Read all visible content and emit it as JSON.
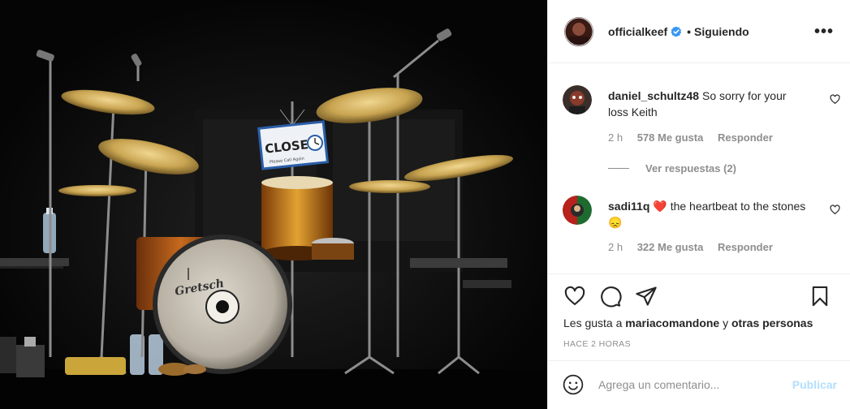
{
  "post": {
    "username": "officialkeef",
    "separator": "•",
    "follow_status": "Siguiendo",
    "more_label": "•••",
    "closed_sign": {
      "title": "CLOSED",
      "subtitle": "Please Call Again"
    },
    "drum_brand": "Gretsch"
  },
  "comments": [
    {
      "user": "daniel_schultz48",
      "text": "So sorry for your loss Keith",
      "time": "2 h",
      "likes": "578 Me gusta",
      "reply": "Responder"
    },
    {
      "user": "sadi11q",
      "text": "❤️ the heartbeat to the stones 😞",
      "time": "2 h",
      "likes": "322 Me gusta",
      "reply": "Responder"
    }
  ],
  "view_replies": "Ver respuestas (2)",
  "likes_line": {
    "prefix": "Les gusta a",
    "user": "mariacomandone",
    "joiner": "y",
    "others": "otras personas"
  },
  "time_ago": "HACE 2 HORAS",
  "add_comment": {
    "placeholder": "Agrega un comentario...",
    "publish": "Publicar"
  },
  "colors": {
    "verified": "#3897f0",
    "publish_disabled": "#b2dffc",
    "muted": "#8e8e8e",
    "heart_red": "#ed4956"
  },
  "icons": [
    "verified-badge-icon",
    "more-options-icon",
    "heart-icon",
    "comment-icon",
    "share-icon",
    "bookmark-icon",
    "emoji-icon"
  ]
}
